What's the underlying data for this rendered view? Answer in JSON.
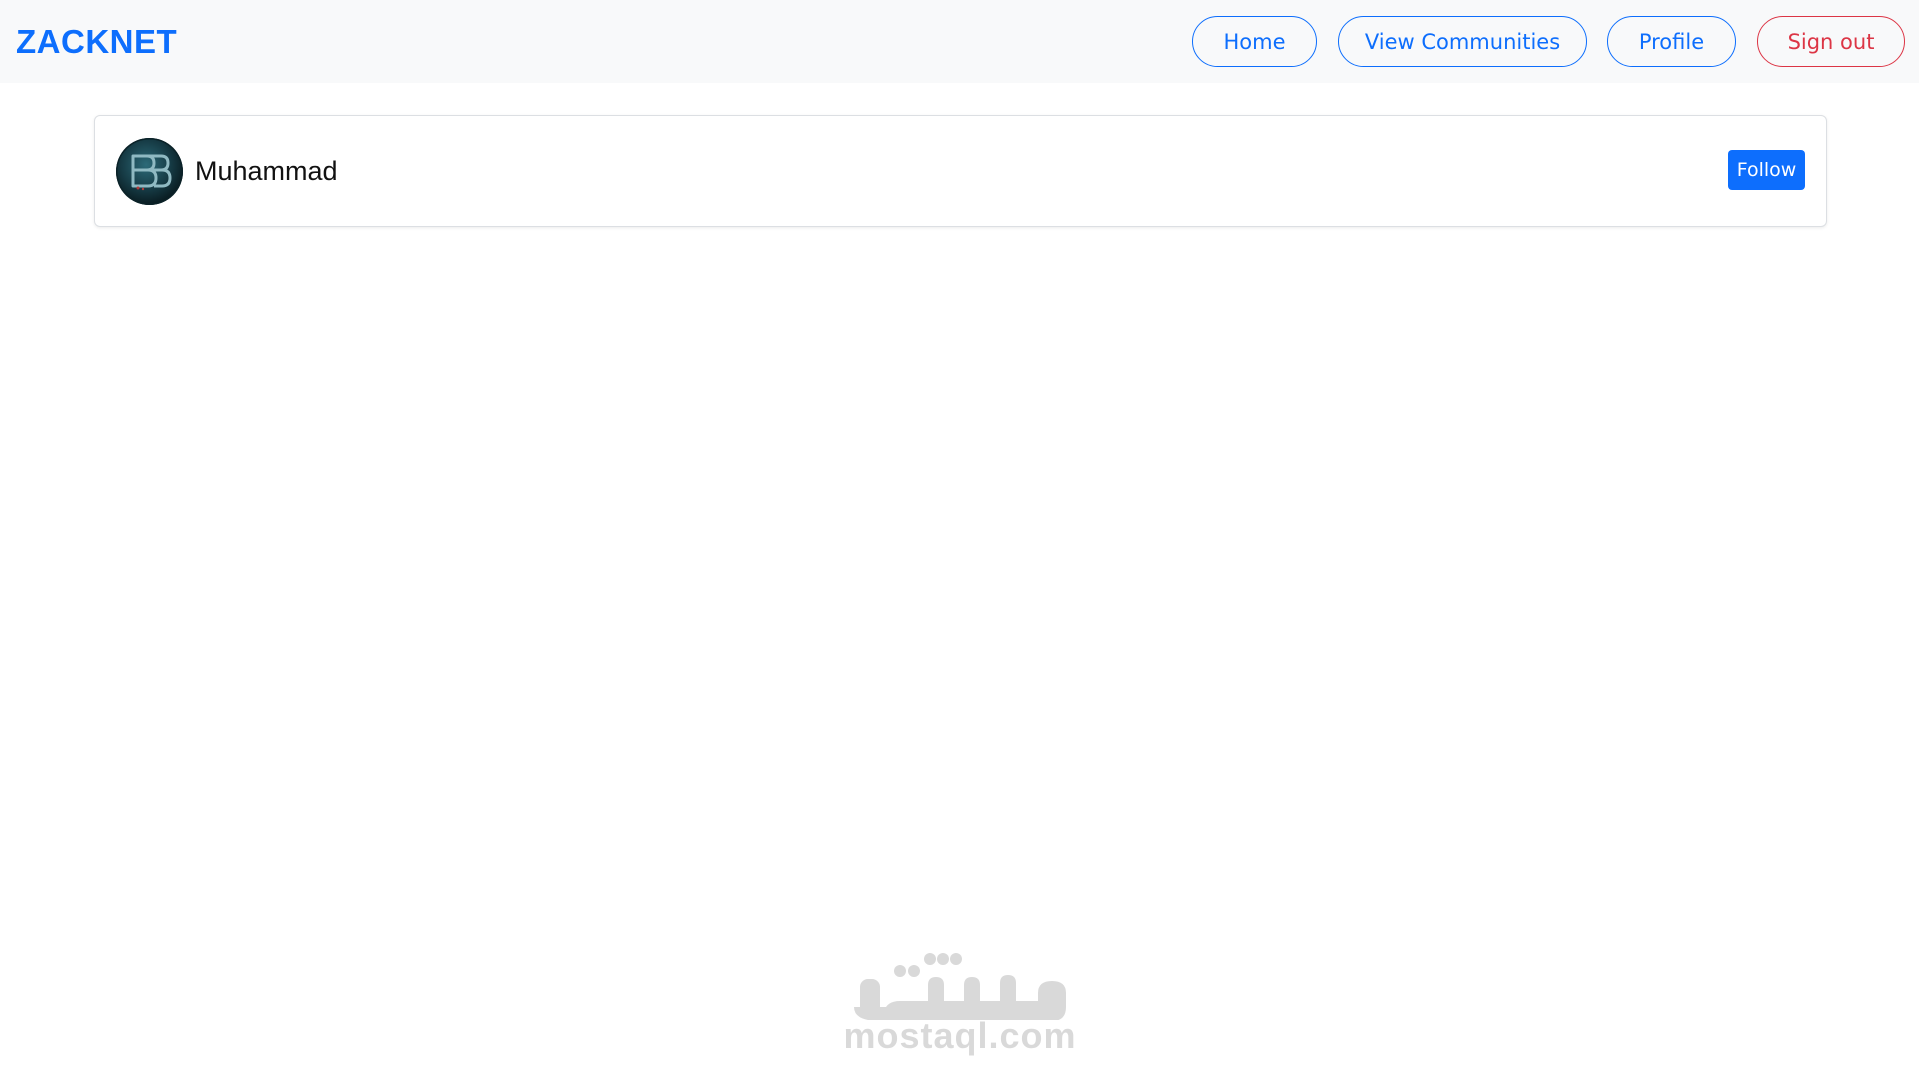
{
  "navbar": {
    "brand": "ZACKNET",
    "home_label": "Home",
    "communities_label": "View Communities",
    "profile_label": "Profile",
    "signout_label": "Sign out"
  },
  "user_card": {
    "name": "Muhammad",
    "follow_label": "Follow"
  },
  "watermark": {
    "text": "mostaql.com"
  },
  "colors": {
    "primary": "#0d6efd",
    "danger": "#dc3545",
    "navbar_bg": "#f8f9fa"
  }
}
